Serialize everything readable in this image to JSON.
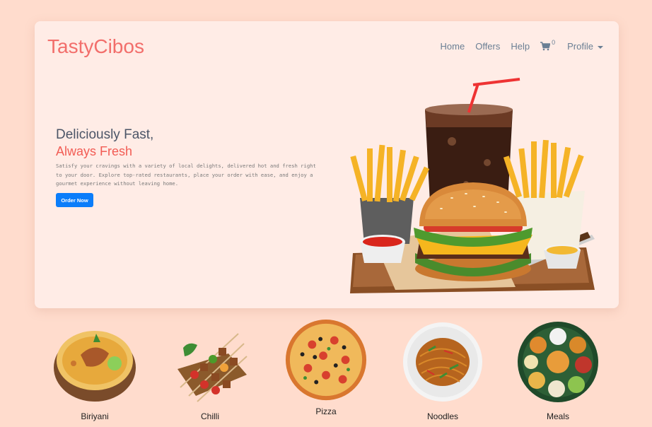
{
  "brand": "TastyCibos",
  "nav": {
    "home": "Home",
    "offers": "Offers",
    "help": "Help",
    "cart_count": "0",
    "profile": "Profile"
  },
  "hero": {
    "line1": "Deliciously Fast,",
    "line2": "Always Fresh",
    "description": "Satisfy your cravings with a variety of local delights, delivered hot and fresh right to your door. Explore top-rated restaurants, place your order with ease, and enjoy a gourmet experience without leaving home.",
    "cta": "Order Now"
  },
  "categories": [
    {
      "label": "Biriyani"
    },
    {
      "label": "Chilli"
    },
    {
      "label": "Pizza"
    },
    {
      "label": "Noodles"
    },
    {
      "label": "Meals"
    }
  ],
  "colors": {
    "page_bg": "#ffdccd",
    "card_bg": "#ffece6",
    "brand": "#f26e6b",
    "accent": "#f25c54",
    "button": "#0b7dfa",
    "nav_text": "#6a7f94"
  }
}
